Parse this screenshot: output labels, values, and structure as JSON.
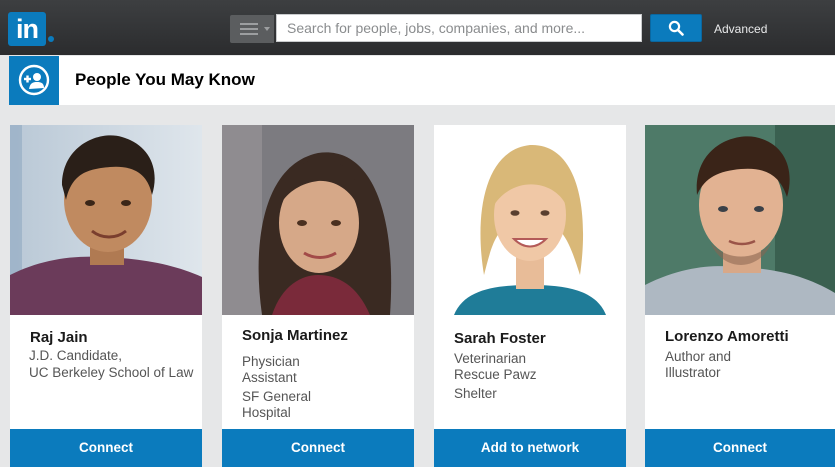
{
  "header": {
    "logo_text": "in",
    "search_placeholder": "Search for people, jobs, companies, and more...",
    "advanced_label": "Advanced"
  },
  "section": {
    "title": "People You May Know"
  },
  "colors": {
    "brand": "#0b7bbd",
    "topbar": "#333436",
    "page_bg": "#e6e7e8"
  },
  "people": [
    {
      "name": "Raj Jain",
      "title_lines": [
        "J.D. Candidate,",
        "UC Berkeley School of Law"
      ],
      "action": "Connect"
    },
    {
      "name": "Sonja Martinez",
      "title_lines": [
        "Physician",
        "Assistant",
        "SF General",
        "Hospital"
      ],
      "action": "Connect"
    },
    {
      "name": "Sarah Foster",
      "title_lines": [
        "Veterinarian",
        "Rescue Pawz",
        "Shelter"
      ],
      "action": "Add to network"
    },
    {
      "name": "Lorenzo Amoretti",
      "title_lines": [
        "Author and",
        "Illustrator"
      ],
      "action": "Connect"
    }
  ]
}
